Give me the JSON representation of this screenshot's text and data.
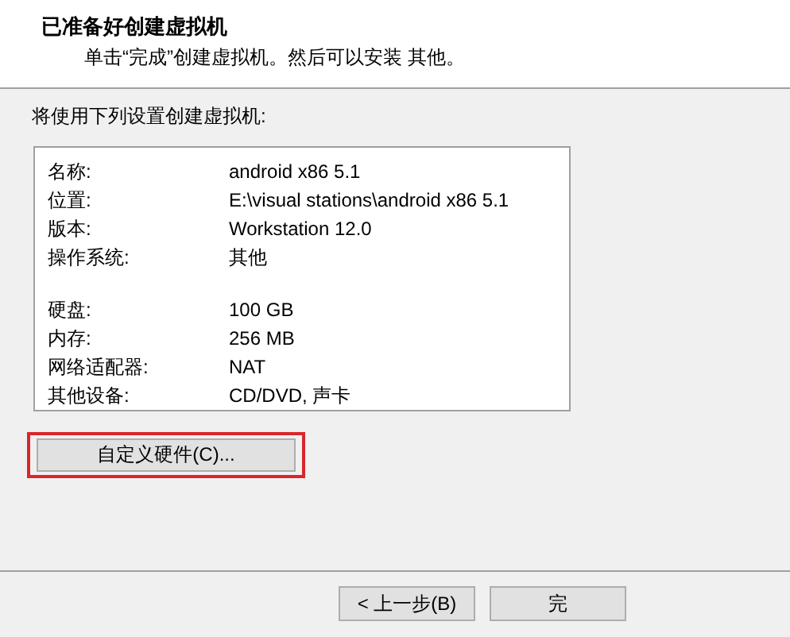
{
  "header": {
    "title": "已准备好创建虚拟机",
    "subtitle": "单击“完成”创建虚拟机。然后可以安装 其他。"
  },
  "summary_label": "将使用下列设置创建虚拟机:",
  "settings": [
    {
      "kind": "row",
      "label": "名称:",
      "value": "android x86 5.1"
    },
    {
      "kind": "row",
      "label": "位置:",
      "value": "E:\\visual stations\\android x86 5.1"
    },
    {
      "kind": "row",
      "label": "版本:",
      "value": "Workstation 12.0"
    },
    {
      "kind": "row",
      "label": "操作系统:",
      "value": "其他"
    },
    {
      "kind": "gap"
    },
    {
      "kind": "row",
      "label": "硬盘:",
      "value": "100 GB"
    },
    {
      "kind": "row",
      "label": "内存:",
      "value": "256 MB"
    },
    {
      "kind": "row",
      "label": "网络适配器:",
      "value": "NAT"
    },
    {
      "kind": "row",
      "label": "其他设备:",
      "value": "CD/DVD, 声卡"
    }
  ],
  "customize_button": {
    "label": "自定义硬件(C)...",
    "highlighted": true
  },
  "footer_buttons": [
    {
      "label": "< 上一步(B)"
    },
    {
      "label": "完"
    }
  ]
}
